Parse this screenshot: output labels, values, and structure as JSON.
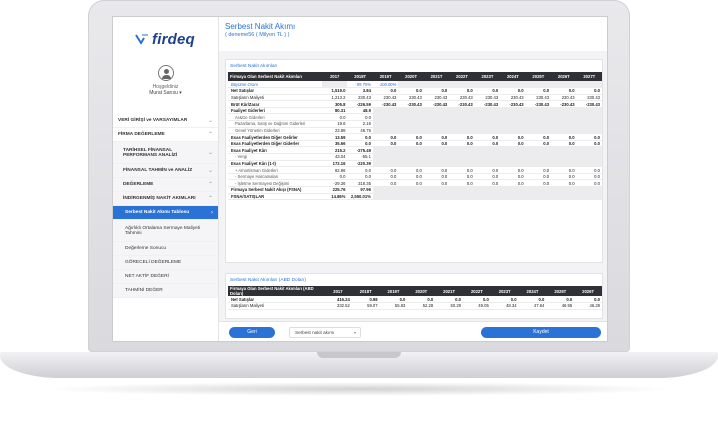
{
  "brand": {
    "name": "firdeq"
  },
  "user": {
    "greeting": "Hoşgeldiniz",
    "name": "Murat Sarısu ▾"
  },
  "menu": [
    {
      "label": "VERİ GİRİŞİ ve VARSAYIMLAR"
    },
    {
      "label": "FİRMA DEĞERLEME"
    },
    {
      "label": "TARİHSEL FİNANSAL PERFORMANS ANALİZİ"
    },
    {
      "label": "FİNANSAL TAHMİN ve ANALİZ"
    },
    {
      "label": "DEĞERLEME"
    },
    {
      "label": "İNDİRGENMİŞ NAKİT AKIMLARI"
    },
    {
      "label": "Serbest Nakit Akımı Tablosu"
    },
    {
      "label": "Ağırlıklı Ortalama Sermaye Maliyeti Tahmini"
    },
    {
      "label": "Değerleme Sonucu"
    },
    {
      "label": "GÖRECELİ DEĞERLEME"
    },
    {
      "label": "NET AKTİF DEĞERİ"
    },
    {
      "label": "TAHMİNİ DEĞER"
    }
  ],
  "page": {
    "title": "Serbest Nakit Akımı",
    "subtitle": "( deneme56 ( Milyon TL ) )"
  },
  "table1": {
    "card_title": "Serbest Nakit Akımları",
    "headers": [
      "Firmaya Olan Serbest Nakit Akımları",
      "2017",
      "2018T",
      "2019T",
      "2020T",
      "2021T",
      "2022T",
      "2023T",
      "2024T",
      "2025T",
      "2026T",
      "2027T"
    ],
    "rows": [
      {
        "style": "grow",
        "cells": [
          "Büyüme Oranı",
          "",
          "-99.75%",
          "-100.00%",
          "",
          "",
          "",
          "",
          "",
          "",
          "",
          ""
        ]
      },
      {
        "style": "bold",
        "cells": [
          "Net Satışlar",
          "1,519.0",
          "3.84",
          "0.0",
          "0.0",
          "0.0",
          "0.0",
          "0.0",
          "0.0",
          "0.0",
          "0.0",
          "0.0"
        ]
      },
      {
        "style": "",
        "cells": [
          "Satışların Maliyeti",
          "1,213.2",
          "230.43",
          "230.43",
          "230.43",
          "230.43",
          "230.43",
          "230.43",
          "230.43",
          "230.43",
          "230.43",
          "230.43"
        ]
      },
      {
        "style": "bold",
        "cells": [
          "Brüt Kâr/Zarar",
          "305.8",
          "-226.59",
          "-230.43",
          "-230.43",
          "-230.43",
          "-230.43",
          "-230.43",
          "-230.43",
          "-230.43",
          "-230.43",
          "-230.43"
        ]
      },
      {
        "style": "bold",
        "cells": [
          "Faaliyet Giderleri",
          "80.31",
          "48.9",
          "",
          "",
          "",
          "",
          "",
          "",
          "",
          "",
          ""
        ]
      },
      {
        "style": "ind",
        "cells": [
          "Ar&Ge Giderleri",
          "0.0",
          "0.0",
          "",
          "",
          "",
          "",
          "",
          "",
          "",
          "",
          ""
        ]
      },
      {
        "style": "ind",
        "cells": [
          "Pazarlama, Satış ve Dağıtım Giderleri",
          "19.6",
          "2.16",
          "",
          "",
          "",
          "",
          "",
          "",
          "",
          "",
          ""
        ]
      },
      {
        "style": "ind",
        "cells": [
          "Genel Yönetim Giderleri",
          "23.88",
          "46.75",
          "",
          "",
          "",
          "",
          "",
          "",
          "",
          "",
          ""
        ]
      },
      {
        "style": "bold",
        "cells": [
          "Esas Faaliyetlerden Diğer Gelirler",
          "13.59",
          "0.0",
          "0.0",
          "0.0",
          "0.0",
          "0.0",
          "0.0",
          "0.0",
          "0.0",
          "0.0",
          "0.0"
        ]
      },
      {
        "style": "bold",
        "cells": [
          "Esas Faaliyetlerden Diğer Giderler",
          "35.66",
          "0.0",
          "0.0",
          "0.0",
          "0.0",
          "0.0",
          "0.0",
          "0.0",
          "0.0",
          "0.0",
          "0.0"
        ]
      },
      {
        "style": "bold",
        "cells": [
          "Esas Faaliyet Kârı",
          "215.2",
          "-275.49",
          "",
          "",
          "",
          "",
          "",
          "",
          "",
          "",
          ""
        ]
      },
      {
        "style": "ind",
        "cells": [
          "- Vergi",
          "43.04",
          "-55.1",
          "",
          "",
          "",
          "",
          "",
          "",
          "",
          "",
          ""
        ]
      },
      {
        "style": "bold",
        "cells": [
          "Esas Faaliyet Kârı (1-t)",
          "172.16",
          "-220.39",
          "",
          "",
          "",
          "",
          "",
          "",
          "",
          "",
          ""
        ]
      },
      {
        "style": "ind",
        "cells": [
          "+ Amortisman Giderleri",
          "82.96",
          "0.0",
          "0.0",
          "0.0",
          "0.0",
          "0.0",
          "0.0",
          "0.0",
          "0.0",
          "0.0",
          "0.0"
        ]
      },
      {
        "style": "ind",
        "cells": [
          "- Sermaye Harcamaları",
          "0.0",
          "0.0",
          "0.0",
          "0.0",
          "0.0",
          "0.0",
          "0.0",
          "0.0",
          "0.0",
          "0.0",
          "0.0"
        ]
      },
      {
        "style": "ind",
        "cells": [
          "- İşletme Sermayesi Değişimi",
          "-29.36",
          "318.35",
          "0.0",
          "0.0",
          "0.0",
          "0.0",
          "0.0",
          "0.0",
          "0.0",
          "0.0",
          "0.0"
        ]
      },
      {
        "style": "bold",
        "cells": [
          "Firmaya Serbest Nakit Akışı (FSNA)",
          "225.76",
          "97.96",
          "",
          "",
          "",
          "",
          "",
          "",
          "",
          "",
          ""
        ]
      },
      {
        "style": "bold",
        "cells": [
          "FSNA/SATIŞLAR",
          "14.86%",
          "2,550.01%",
          "",
          "",
          "",
          "",
          "",
          "",
          "",
          "",
          ""
        ]
      }
    ]
  },
  "table2": {
    "card_title": "Serbest Nakit Akımları (ABD Doları)",
    "headers": [
      "Firmaya Olan Serbest Nakit Akımları (ABD Doları)",
      "2017",
      "2018T",
      "2019T",
      "2020T",
      "2021T",
      "2022T",
      "2023T",
      "2024T",
      "2025T",
      "2026T"
    ],
    "rows": [
      {
        "style": "bold",
        "cells": [
          "Net Satışlar",
          "416.24",
          "0.98",
          "0.0",
          "0.0",
          "0.0",
          "0.0",
          "0.0",
          "0.0",
          "0.0",
          "0.0"
        ]
      },
      {
        "style": "",
        "cells": [
          "Satışların Maliyeti",
          "332.52",
          "59.07",
          "55.83",
          "52.28",
          "50.29",
          "49.05",
          "48.34",
          "47.64",
          "46.95",
          "46.28"
        ]
      }
    ]
  },
  "footer": {
    "back_label": "Geri",
    "select_value": "Serbest nakit akımı",
    "save_label": "Kaydet"
  }
}
